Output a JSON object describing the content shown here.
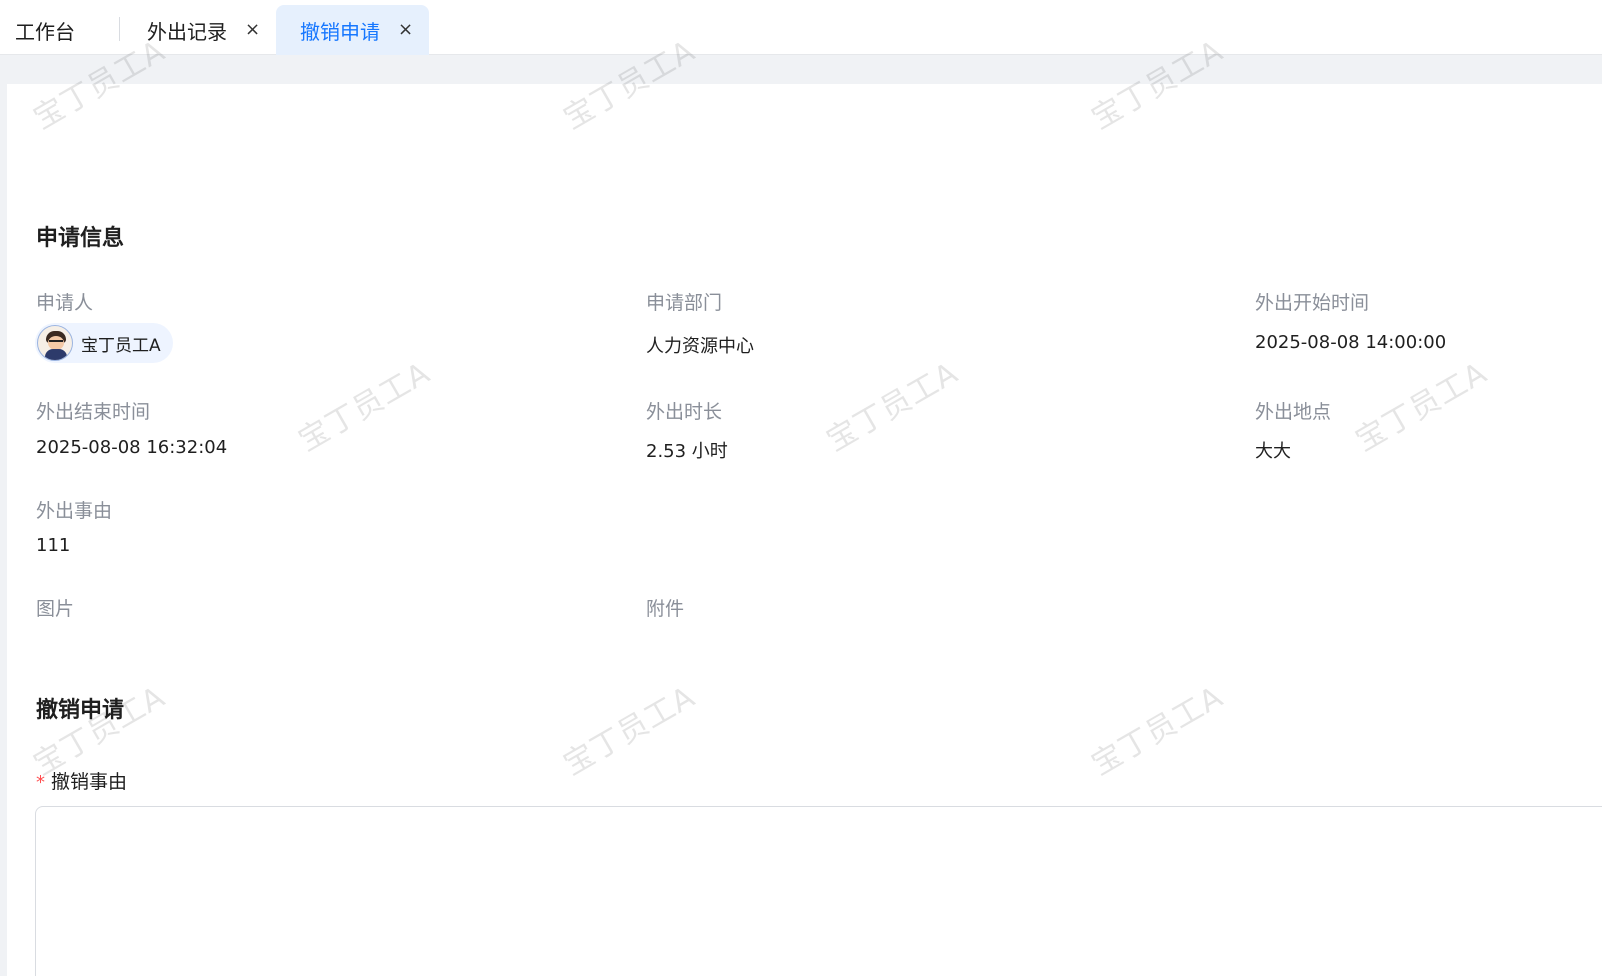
{
  "tabs": {
    "home": "工作台",
    "outing": "外出记录",
    "cancel": "撤销申请",
    "close_glyph": "×"
  },
  "info": {
    "section_title": "申请信息",
    "applicant_label": "申请人",
    "applicant_name": "宝丁员工A",
    "dept_label": "申请部门",
    "dept_value": "人力资源中心",
    "start_label": "外出开始时间",
    "start_value": "2025-08-08 14:00:00",
    "end_label": "外出结束时间",
    "end_value": "2025-08-08 16:32:04",
    "duration_label": "外出时长",
    "duration_value": "2.53 小时",
    "location_label": "外出地点",
    "location_value": "大大",
    "reason_label": "外出事由",
    "reason_value": "111",
    "image_label": "图片",
    "attachment_label": "附件"
  },
  "cancel": {
    "section_title": "撤销申请",
    "required_mark": "*",
    "reason_label": "撤销事由",
    "reason_value": ""
  },
  "watermark": "宝丁员工A"
}
